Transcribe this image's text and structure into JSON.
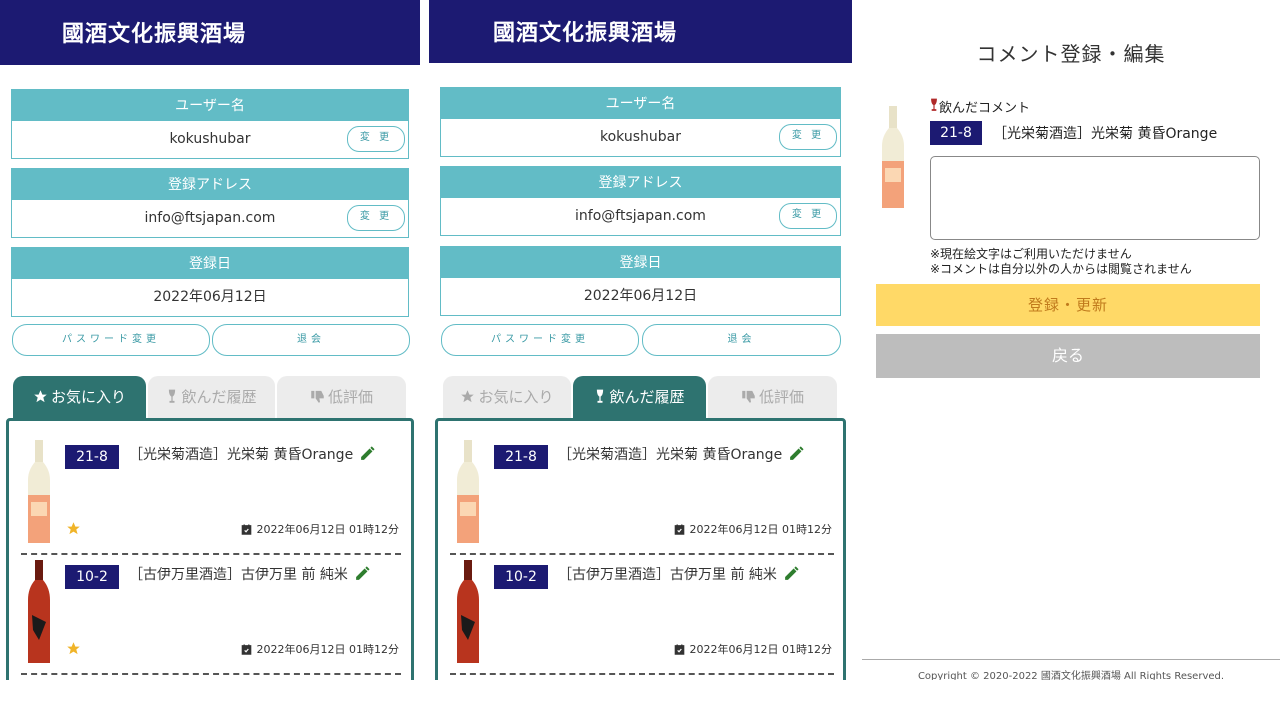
{
  "app": {
    "logo_text": "國酒文化振興酒場"
  },
  "profile": {
    "username_label": "ユーザー名",
    "username_value": "kokushubar",
    "email_label": "登録アドレス",
    "email_value": "info@ftsjapan.com",
    "regdate_label": "登録日",
    "regdate_value": "2022年06月12日",
    "change_label": "変 更",
    "password_change_label": "パスワード変更",
    "withdraw_label": "退会"
  },
  "tabs": [
    {
      "label": "お気に入り",
      "icon": "star-icon"
    },
    {
      "label": "飲んだ履歴",
      "icon": "wineglass-icon"
    },
    {
      "label": "低評価",
      "icon": "thumbs-down-icon"
    }
  ],
  "panel1_active_tab": 0,
  "panel2_active_tab": 1,
  "items": [
    {
      "code": "21-8",
      "name": "［光栄菊酒造］光栄菊 黄昏Orange",
      "date": "2022年06月12日 01時12分",
      "favorite": true,
      "bottle_color": "#f3a27a"
    },
    {
      "code": "10-2",
      "name": "［古伊万里酒造］古伊万里 前 純米",
      "date": "2022年06月12日 01時12分",
      "favorite": true,
      "bottle_color": "#b8341e"
    }
  ],
  "comment_page": {
    "title": "コメント登録・編集",
    "comment_label": "飲んだコメント",
    "code": "21-8",
    "name": "［光栄菊酒造］光栄菊 黄昏Orange",
    "note1": "※現在絵文字はご利用いただけません",
    "note2": "※コメントは自分以外の人からは閲覧されません",
    "submit_label": "登録・更新",
    "back_label": "戻る",
    "copyright": "Copyright © 2020-2022 國酒文化振興酒場 All Rights Reserved."
  },
  "colors": {
    "navy": "#1c1a72",
    "teal": "#62bcc6",
    "dark_teal": "#2e7370",
    "yellow": "#ffd967",
    "gray": "#bdbdbd",
    "pencil_green": "#2e7d2e",
    "star_gold": "#f0b429"
  }
}
